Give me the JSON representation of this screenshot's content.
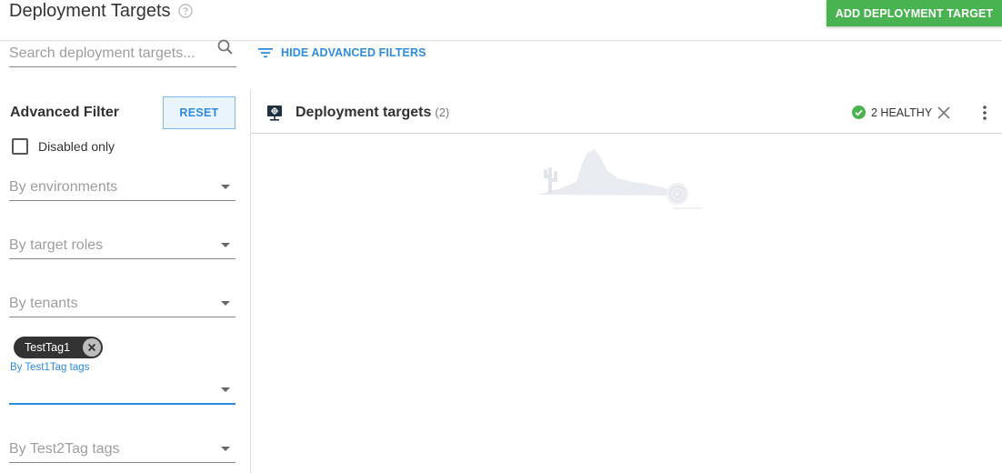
{
  "header": {
    "title": "Deployment Targets",
    "add_button_label": "ADD DEPLOYMENT TARGET"
  },
  "search": {
    "placeholder": "Search deployment targets...",
    "value": ""
  },
  "filters_toggle": {
    "label": "HIDE ADVANCED FILTERS"
  },
  "advanced_filter": {
    "title": "Advanced Filter",
    "reset_label": "RESET",
    "disabled_only_label": "Disabled only",
    "disabled_only_checked": false,
    "environments_placeholder": "By environments",
    "target_roles_placeholder": "By target roles",
    "tenants_placeholder": "By tenants",
    "test1tag": {
      "label": "By Test1Tag tags",
      "chips": [
        "TestTag1"
      ]
    },
    "test2tag_placeholder": "By Test2Tag tags"
  },
  "panel": {
    "title": "Deployment targets",
    "count": "(2)",
    "health_label": "2 HEALTHY"
  },
  "colors": {
    "primary_green": "#48b350",
    "link_blue": "#2f8be0",
    "healthy_green": "#48b350",
    "chip_bg": "#333333"
  },
  "icons": {
    "help": "help-circle-icon",
    "search": "search-icon",
    "filter": "filter-lines-icon",
    "panel": "deployment-target-icon",
    "health": "check-circle-icon",
    "clear": "close-icon",
    "more": "more-vert-icon",
    "chip_remove": "cancel-icon"
  }
}
